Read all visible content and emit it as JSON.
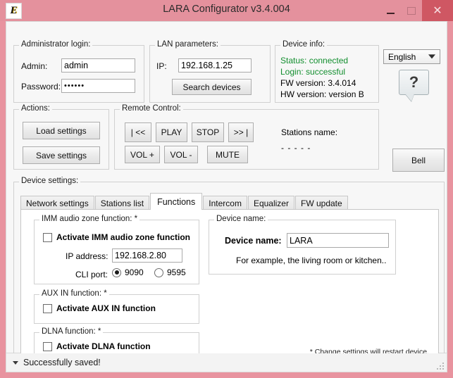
{
  "window": {
    "title": "LARA Configurator v3.4.004",
    "app_icon": "E",
    "minimize": "–",
    "maximize": "□",
    "close": "✕"
  },
  "admin": {
    "legend": "Administrator login:",
    "admin_label": "Admin:",
    "admin_value": "admin",
    "password_label": "Password:",
    "password_value": "••••••"
  },
  "lan": {
    "legend": "LAN parameters:",
    "ip_label": "IP:",
    "ip_value": "192.168.1.25",
    "search_button": "Search devices"
  },
  "device_info": {
    "legend": "Device info:",
    "status": "Status: connected",
    "login": "Login: successful",
    "fw": "FW version: 3.4.014",
    "hw": "HW version: version B",
    "status_color": "#128e2e"
  },
  "language": {
    "selected": "English",
    "options": [
      "English"
    ]
  },
  "help": {
    "label": "?"
  },
  "actions": {
    "legend": "Actions:",
    "load": "Load settings",
    "save": "Save settings"
  },
  "remote": {
    "legend": "Remote Control:",
    "prev": "| <<",
    "play": "PLAY",
    "stop": "STOP",
    "next": ">> |",
    "vol_up": "VOL +",
    "vol_down": "VOL -",
    "mute": "MUTE",
    "stations_label": "Stations name:",
    "stations_value": "- - - - -"
  },
  "bell": {
    "label": "Bell"
  },
  "device_settings": {
    "legend": "Device settings:",
    "tabs": [
      {
        "label": "Network settings",
        "active": false
      },
      {
        "label": "Stations list",
        "active": false
      },
      {
        "label": "Functions",
        "active": true
      },
      {
        "label": "Intercom",
        "active": false
      },
      {
        "label": "Equalizer",
        "active": false
      },
      {
        "label": "FW update",
        "active": false
      }
    ]
  },
  "imm": {
    "legend": "IMM audio zone function: *",
    "checkbox_label": "Activate IMM audio zone function",
    "checked": false,
    "ip_label": "IP address:",
    "ip_value": "192.168.2.80",
    "cli_label": "CLI port:",
    "port_a": "9090",
    "port_b": "9595",
    "port_selected": "9090"
  },
  "aux": {
    "legend": "AUX IN function: *",
    "checkbox_label": "Activate AUX IN function",
    "checked": false
  },
  "dlna": {
    "legend": "DLNA function: *",
    "checkbox_label": "Activate DLNA function",
    "checked": false
  },
  "device_name": {
    "legend": "Device name:",
    "field_label": "Device name:",
    "value": "LARA",
    "hint": "For example, the living room or kitchen.."
  },
  "footnote": {
    "text": "* Change settings will restart device."
  },
  "statusbar": {
    "message": "Successfully saved!"
  }
}
